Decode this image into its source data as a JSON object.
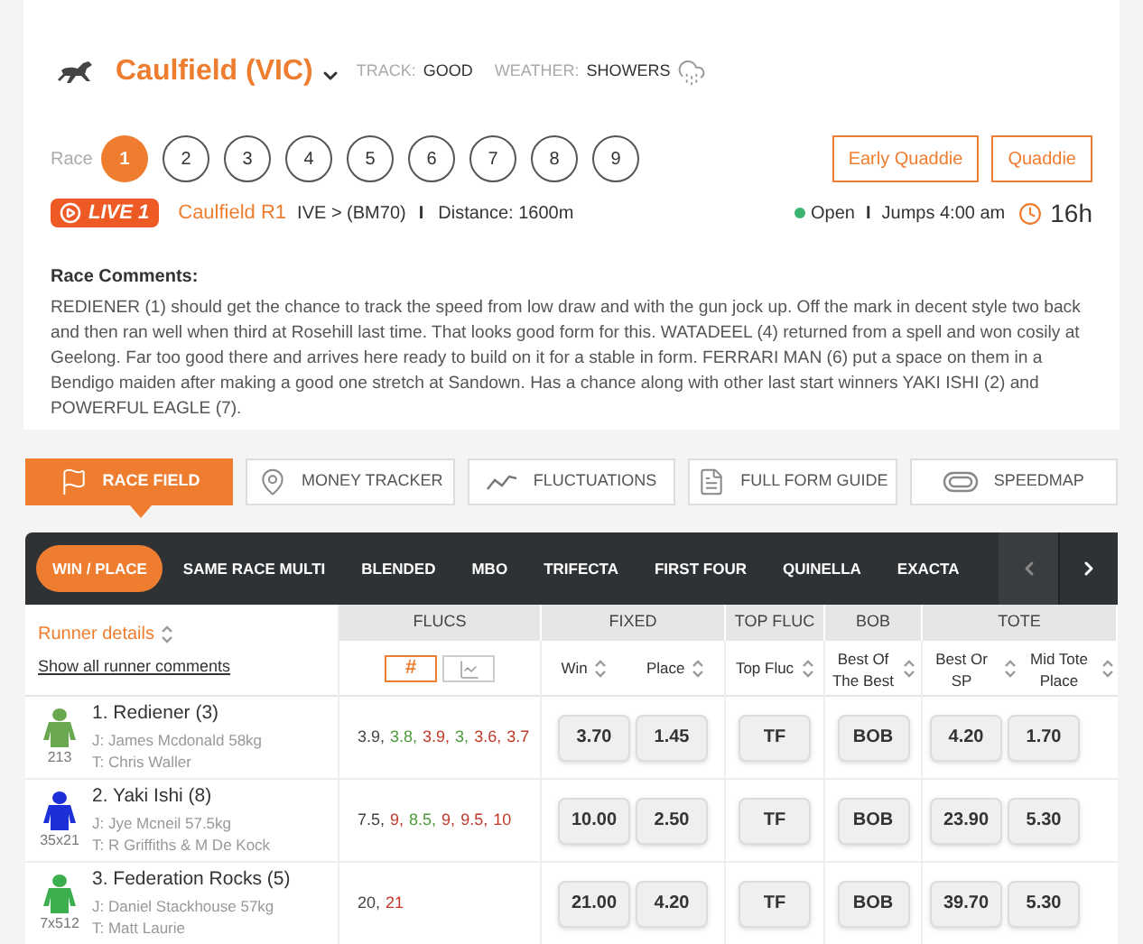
{
  "meeting": {
    "venue": "Caulfield (VIC)",
    "track_label": "TRACK:",
    "track": "GOOD",
    "weather_label": "WEATHER:",
    "weather": "SHOWERS"
  },
  "race_selector": {
    "label": "Race",
    "races": [
      {
        "label": "1",
        "selected": true
      },
      {
        "label": "2",
        "selected": false
      },
      {
        "label": "3",
        "selected": false
      },
      {
        "label": "4",
        "selected": false
      },
      {
        "label": "5",
        "selected": false
      },
      {
        "label": "6",
        "selected": false
      },
      {
        "label": "7",
        "selected": false
      },
      {
        "label": "8",
        "selected": false
      },
      {
        "label": "9",
        "selected": false
      }
    ],
    "buttons": [
      "Early Quaddie",
      "Quaddie"
    ]
  },
  "race_info": {
    "live_badge": "LIVE 1",
    "race_name": "Caulfield R1",
    "class": "IVE > (BM70)",
    "separator": "I",
    "distance": "Distance: 1600m",
    "status": "Open",
    "separator_2": "I",
    "jumps": "Jumps 4:00 am",
    "countdown": "16h"
  },
  "comments": {
    "title": "Race Comments:",
    "text": "REDIENER (1) should get the chance to track the speed from low draw and with the gun jock up. Off the mark in decent style two back and then ran well when third at Rosehill last time. That looks good form for this. WATADEEL (4) returned from a spell and won cosily at Geelong. Far too good there and arrives here ready to build on it for a stable in form. FERRARI MAN (6) put a space on them in a Bendigo maiden after making a good one stretch at Sandown. Has a chance along with other last start winners YAKI ISHI (2) and POWERFUL EAGLE (7)."
  },
  "nav_tabs": [
    {
      "kind": "flag",
      "label": "RACE FIELD",
      "selected": true
    },
    {
      "kind": "pin",
      "label": "MONEY TRACKER",
      "selected": false
    },
    {
      "kind": "line",
      "label": "FLUCTUATIONS",
      "selected": false
    },
    {
      "kind": "document",
      "label": "FULL FORM GUIDE",
      "selected": false
    },
    {
      "kind": "track",
      "label": "SPEEDMAP",
      "selected": false
    }
  ],
  "bet_types": [
    {
      "label": "WIN / PLACE",
      "selected": true
    },
    {
      "label": "SAME RACE MULTI",
      "selected": false
    },
    {
      "label": "BLENDED",
      "selected": false
    },
    {
      "label": "MBO",
      "selected": false
    },
    {
      "label": "TRIFECTA",
      "selected": false
    },
    {
      "label": "FIRST FOUR",
      "selected": false
    },
    {
      "label": "QUINELLA",
      "selected": false
    },
    {
      "label": "EXACTA",
      "selected": false
    }
  ],
  "table": {
    "runner_header": "Runner details",
    "runner_link": "Show all runner comments",
    "groups": [
      "FLUCS",
      "FIXED",
      "TOP FLUC",
      "BOB",
      "TOTE"
    ],
    "flucs_view": [
      {
        "kind": "number",
        "label": "#",
        "selected": true
      },
      {
        "kind": "chart",
        "selected": false
      }
    ],
    "columns": [
      "Win",
      "Place",
      "Top Fluc",
      "Best Of The Best",
      "Best Or SP",
      "Mid Tote Place"
    ],
    "rows": [
      {
        "name": "1. Rediener (3)",
        "jockey": "J: James Mcdonald 58kg",
        "trainer": "T: Chris Waller",
        "silk_label": "213",
        "color": "#6aa84f",
        "flucs": [
          {
            "value": "3.9,",
            "color": "#444444"
          },
          {
            "value": "3.8,",
            "color": "#4a9a3a"
          },
          {
            "value": "3.9,",
            "color": "#c0392b"
          },
          {
            "value": "3,",
            "color": "#4a9a3a"
          },
          {
            "value": "3.6,",
            "color": "#c0392b"
          },
          {
            "value": "3.7",
            "color": "#c0392b"
          }
        ],
        "win": "3.70",
        "place": "1.45",
        "top_fluc": "TF",
        "bob": "BOB",
        "best_or_sp": "4.20",
        "mid_tote": "1.70"
      },
      {
        "name": "2. Yaki Ishi (8)",
        "jockey": "J: Jye Mcneil 57.5kg",
        "trainer": "T: R Griffiths & M De Kock",
        "silk_label": "35x21",
        "color": "#1c2fd8",
        "flucs": [
          {
            "value": "7.5,",
            "color": "#444444"
          },
          {
            "value": "9,",
            "color": "#c0392b"
          },
          {
            "value": "8.5,",
            "color": "#4a9a3a"
          },
          {
            "value": "9,",
            "color": "#c0392b"
          },
          {
            "value": "9.5,",
            "color": "#c0392b"
          },
          {
            "value": "10",
            "color": "#c0392b"
          }
        ],
        "win": "10.00",
        "place": "2.50",
        "top_fluc": "TF",
        "bob": "BOB",
        "best_or_sp": "23.90",
        "mid_tote": "5.30"
      },
      {
        "name": "3. Federation Rocks (5)",
        "jockey": "J: Daniel Stackhouse 57kg",
        "trainer": "T: Matt Laurie",
        "silk_label": "7x512",
        "color": "#3cae4e",
        "flucs": [
          {
            "value": "20,",
            "color": "#444444"
          },
          {
            "value": "21",
            "color": "#c0392b"
          }
        ],
        "win": "21.00",
        "place": "4.20",
        "top_fluc": "TF",
        "bob": "BOB",
        "best_or_sp": "39.70",
        "mid_tote": "5.30"
      }
    ]
  }
}
